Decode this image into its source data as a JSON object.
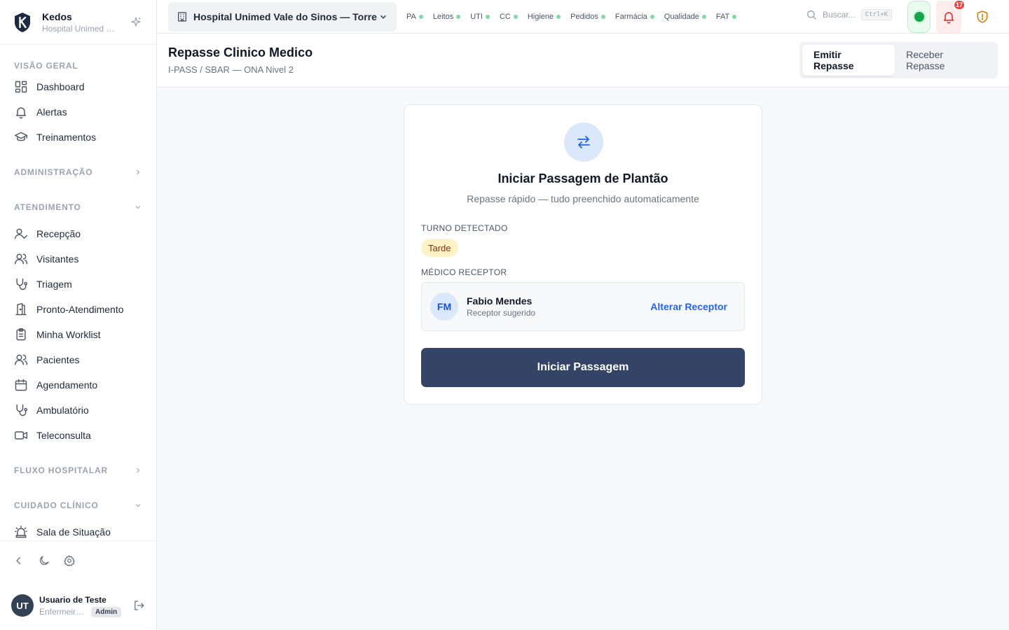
{
  "brand": {
    "name": "Kedos",
    "subtitle": "Hospital Unimed Vale do Sinos"
  },
  "sidebar": {
    "sections": [
      {
        "title": "VISÃO GERAL",
        "items": [
          "Dashboard",
          "Alertas",
          "Treinamentos"
        ]
      },
      {
        "title": "ADMINISTRAÇÃO"
      },
      {
        "title": "ATENDIMENTO",
        "items": [
          "Recepção",
          "Visitantes",
          "Triagem",
          "Pronto-Atendimento",
          "Minha Worklist",
          "Pacientes",
          "Agendamento",
          "Ambulatório",
          "Teleconsulta"
        ]
      },
      {
        "title": "FLUXO HOSPITALAR"
      },
      {
        "title": "CUIDADO CLÍNICO",
        "items": [
          "Sala de Situação"
        ]
      }
    ]
  },
  "user": {
    "initials": "UT",
    "name": "Usuario de Teste",
    "role": "Enfermeiro(a)",
    "badge": "Admin"
  },
  "topbar": {
    "hospital": "Hospital Unimed Vale do Sinos — Torre I",
    "modules": [
      "PA",
      "Leitos",
      "UTI",
      "CC",
      "Higiene",
      "Pedidos",
      "Farmácia",
      "Qualidade",
      "FAT"
    ],
    "search_placeholder": "Buscar...",
    "search_shortcut": "Ctrl+K",
    "notifications": "17"
  },
  "header": {
    "title": "Repasse Clinico Medico",
    "subtitle": "I-PASS / SBAR — ONA Nivel 2",
    "tabs": [
      "Emitir Repasse",
      "Receber Repasse"
    ]
  },
  "card": {
    "title": "Iniciar Passagem de Plantão",
    "subtitle": "Repasse rápido — tudo preenchido automaticamente",
    "shift_label": "TURNO DETECTADO",
    "shift_value": "Tarde",
    "receiver_label": "MÉDICO RECEPTOR",
    "receiver_initials": "FM",
    "receiver_name": "Fabio Mendes",
    "receiver_sub": "Receptor sugerido",
    "change_receiver": "Alterar Receptor",
    "primary_button": "Iniciar Passagem"
  },
  "colors": {
    "accent": "#2563eb",
    "primary_button": "#334466",
    "alert": "#dc2626",
    "online": "#16a34a"
  }
}
